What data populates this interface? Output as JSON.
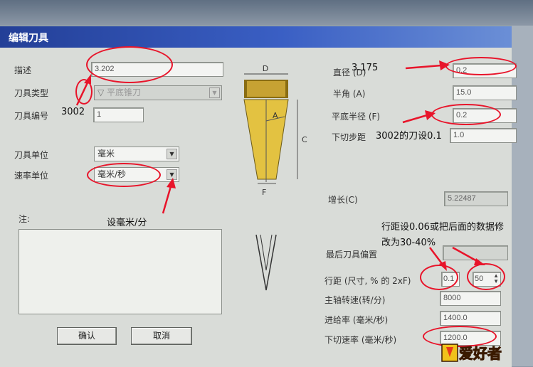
{
  "dialog": {
    "title": "编辑刀具",
    "description_label": "描述",
    "description_value": "3.202",
    "tool_type_label": "刀具类型",
    "tool_type_value": "平底锥刀",
    "tool_number_label": "刀具编号",
    "tool_number_value": "1",
    "tool_unit_label": "刀具单位",
    "tool_unit_value": "毫米",
    "rate_unit_label": "速率单位",
    "rate_unit_value": "毫米/秒",
    "notes_label": "注:",
    "ok_label": "确认",
    "cancel_label": "取消",
    "diameter_label": "直径 (D)",
    "diameter_value": "0.2",
    "half_angle_label": "半角 (A)",
    "half_angle_value": "15.0",
    "flat_radius_label": "平底半径 (F)",
    "flat_radius_value": "0.2",
    "step_down_label": "下切步距",
    "step_down_value": "1.0",
    "increment_label": "增长(C)",
    "increment_value": "5.22487",
    "last_offset_label": "最后刀具偏置",
    "stepover_label": "行距 (尺寸, % 的 2xF)",
    "stepover_value": "0.1",
    "stepover_percent": "50",
    "spindle_label": "主轴转速(转/分)",
    "spindle_value": "8000",
    "feed_label": "进给率 (毫米/秒)",
    "feed_value": "1400.0",
    "plunge_label": "下切速率 (毫米/秒)",
    "plunge_value": "1200.0",
    "diagram": {
      "d": "D",
      "a": "A",
      "c": "C",
      "f": "F"
    }
  },
  "annotations": {
    "tool_3002": "3002",
    "diameter_note": "3.175",
    "flat_radius_note": "3002的刀设0.1",
    "rate_unit_note": "设毫米/分",
    "stepover_note_1": "行距设0.06或把后面的数据修",
    "stepover_note_2": "改为30-40%"
  },
  "watermark": {
    "text": "爱好者"
  },
  "colors": {
    "annotation": "#e8142a",
    "titlebar": "#233f97",
    "tool_gold": "#e3c241"
  }
}
